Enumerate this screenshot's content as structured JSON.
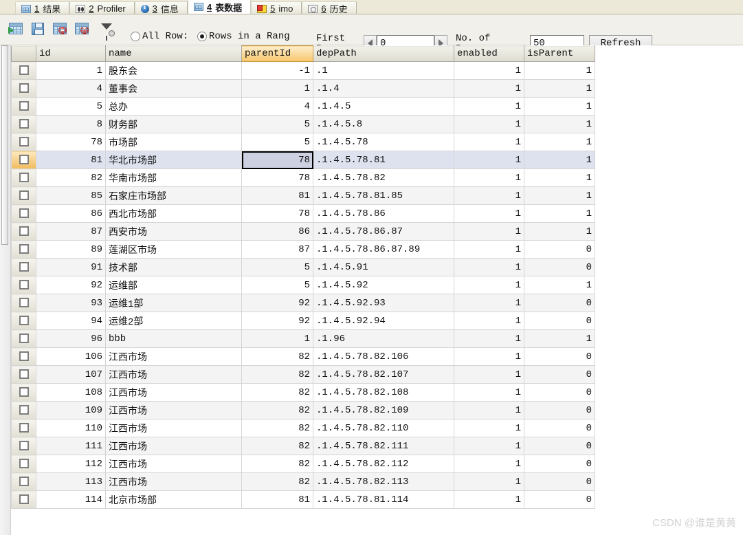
{
  "tabs": [
    {
      "num": "1",
      "label": "结果",
      "icon": "grid-icon",
      "active": false
    },
    {
      "num": "2",
      "label": "Profiler",
      "icon": "profiler-icon",
      "active": false
    },
    {
      "num": "3",
      "label": "信息",
      "icon": "info-icon",
      "active": false
    },
    {
      "num": "4",
      "label": "表数据",
      "icon": "grid-icon",
      "active": true
    },
    {
      "num": "5",
      "label": "imo",
      "icon": "imo-icon",
      "active": false
    },
    {
      "num": "6",
      "label": "历史",
      "icon": "history-icon",
      "active": false
    }
  ],
  "toolbar": {
    "buttons": [
      {
        "name": "add-row-button",
        "icon": "grid-add-icon"
      },
      {
        "name": "save-button",
        "icon": "floppy-save-icon"
      },
      {
        "name": "delete-row-button",
        "icon": "grid-delete-icon"
      },
      {
        "name": "cancel-row-button",
        "icon": "grid-cancel-icon"
      },
      {
        "name": "filter-button",
        "icon": "funnel-filter-icon"
      }
    ],
    "radio_all_rows": "All Row:",
    "radio_rows_in_range": "Rows in a Rang",
    "radio_selected": "rows_in_range",
    "first_row_label": "First\nRow:",
    "first_row_value": "0",
    "no_of_rows_label": "No. of\nRows:",
    "no_of_rows_value": "50",
    "refresh_label": "Refresh"
  },
  "table": {
    "columns": [
      "id",
      "name",
      "parentId",
      "depPath",
      "enabled",
      "isParent"
    ],
    "selected_column": "parentId",
    "selected_row_index": 5,
    "rows": [
      {
        "id": "1",
        "name": "股东会",
        "parentId": "-1",
        "depPath": ".1",
        "enabled": "1",
        "isParent": "1"
      },
      {
        "id": "4",
        "name": "董事会",
        "parentId": "1",
        "depPath": ".1.4",
        "enabled": "1",
        "isParent": "1"
      },
      {
        "id": "5",
        "name": "总办",
        "parentId": "4",
        "depPath": ".1.4.5",
        "enabled": "1",
        "isParent": "1"
      },
      {
        "id": "8",
        "name": "财务部",
        "parentId": "5",
        "depPath": ".1.4.5.8",
        "enabled": "1",
        "isParent": "1"
      },
      {
        "id": "78",
        "name": "市场部",
        "parentId": "5",
        "depPath": ".1.4.5.78",
        "enabled": "1",
        "isParent": "1"
      },
      {
        "id": "81",
        "name": "华北市场部",
        "parentId": "78",
        "depPath": ".1.4.5.78.81",
        "enabled": "1",
        "isParent": "1"
      },
      {
        "id": "82",
        "name": "华南市场部",
        "parentId": "78",
        "depPath": ".1.4.5.78.82",
        "enabled": "1",
        "isParent": "1"
      },
      {
        "id": "85",
        "name": "石家庄市场部",
        "parentId": "81",
        "depPath": ".1.4.5.78.81.85",
        "enabled": "1",
        "isParent": "1"
      },
      {
        "id": "86",
        "name": "西北市场部",
        "parentId": "78",
        "depPath": ".1.4.5.78.86",
        "enabled": "1",
        "isParent": "1"
      },
      {
        "id": "87",
        "name": "西安市场",
        "parentId": "86",
        "depPath": ".1.4.5.78.86.87",
        "enabled": "1",
        "isParent": "1"
      },
      {
        "id": "89",
        "name": "莲湖区市场",
        "parentId": "87",
        "depPath": ".1.4.5.78.86.87.89",
        "enabled": "1",
        "isParent": "0"
      },
      {
        "id": "91",
        "name": "技术部",
        "parentId": "5",
        "depPath": ".1.4.5.91",
        "enabled": "1",
        "isParent": "0"
      },
      {
        "id": "92",
        "name": "运维部",
        "parentId": "5",
        "depPath": ".1.4.5.92",
        "enabled": "1",
        "isParent": "1"
      },
      {
        "id": "93",
        "name": "运维1部",
        "parentId": "92",
        "depPath": ".1.4.5.92.93",
        "enabled": "1",
        "isParent": "0"
      },
      {
        "id": "94",
        "name": "运维2部",
        "parentId": "92",
        "depPath": ".1.4.5.92.94",
        "enabled": "1",
        "isParent": "0"
      },
      {
        "id": "96",
        "name": "bbb",
        "parentId": "1",
        "depPath": ".1.96",
        "enabled": "1",
        "isParent": "1"
      },
      {
        "id": "106",
        "name": "江西市场",
        "parentId": "82",
        "depPath": ".1.4.5.78.82.106",
        "enabled": "1",
        "isParent": "0"
      },
      {
        "id": "107",
        "name": "江西市场",
        "parentId": "82",
        "depPath": ".1.4.5.78.82.107",
        "enabled": "1",
        "isParent": "0"
      },
      {
        "id": "108",
        "name": "江西市场",
        "parentId": "82",
        "depPath": ".1.4.5.78.82.108",
        "enabled": "1",
        "isParent": "0"
      },
      {
        "id": "109",
        "name": "江西市场",
        "parentId": "82",
        "depPath": ".1.4.5.78.82.109",
        "enabled": "1",
        "isParent": "0"
      },
      {
        "id": "110",
        "name": "江西市场",
        "parentId": "82",
        "depPath": ".1.4.5.78.82.110",
        "enabled": "1",
        "isParent": "0"
      },
      {
        "id": "111",
        "name": "江西市场",
        "parentId": "82",
        "depPath": ".1.4.5.78.82.111",
        "enabled": "1",
        "isParent": "0"
      },
      {
        "id": "112",
        "name": "江西市场",
        "parentId": "82",
        "depPath": ".1.4.5.78.82.112",
        "enabled": "1",
        "isParent": "0"
      },
      {
        "id": "113",
        "name": "江西市场",
        "parentId": "82",
        "depPath": ".1.4.5.78.82.113",
        "enabled": "1",
        "isParent": "0"
      },
      {
        "id": "114",
        "name": "北京市场部",
        "parentId": "81",
        "depPath": ".1.4.5.78.81.114",
        "enabled": "1",
        "isParent": "0"
      }
    ]
  },
  "watermark": "CSDN @谁是黄黄",
  "colors": {
    "selected_column_header": "#f7c66a",
    "selected_row": "#dde2ee",
    "toolbar_bg": "#f1f0ea"
  }
}
